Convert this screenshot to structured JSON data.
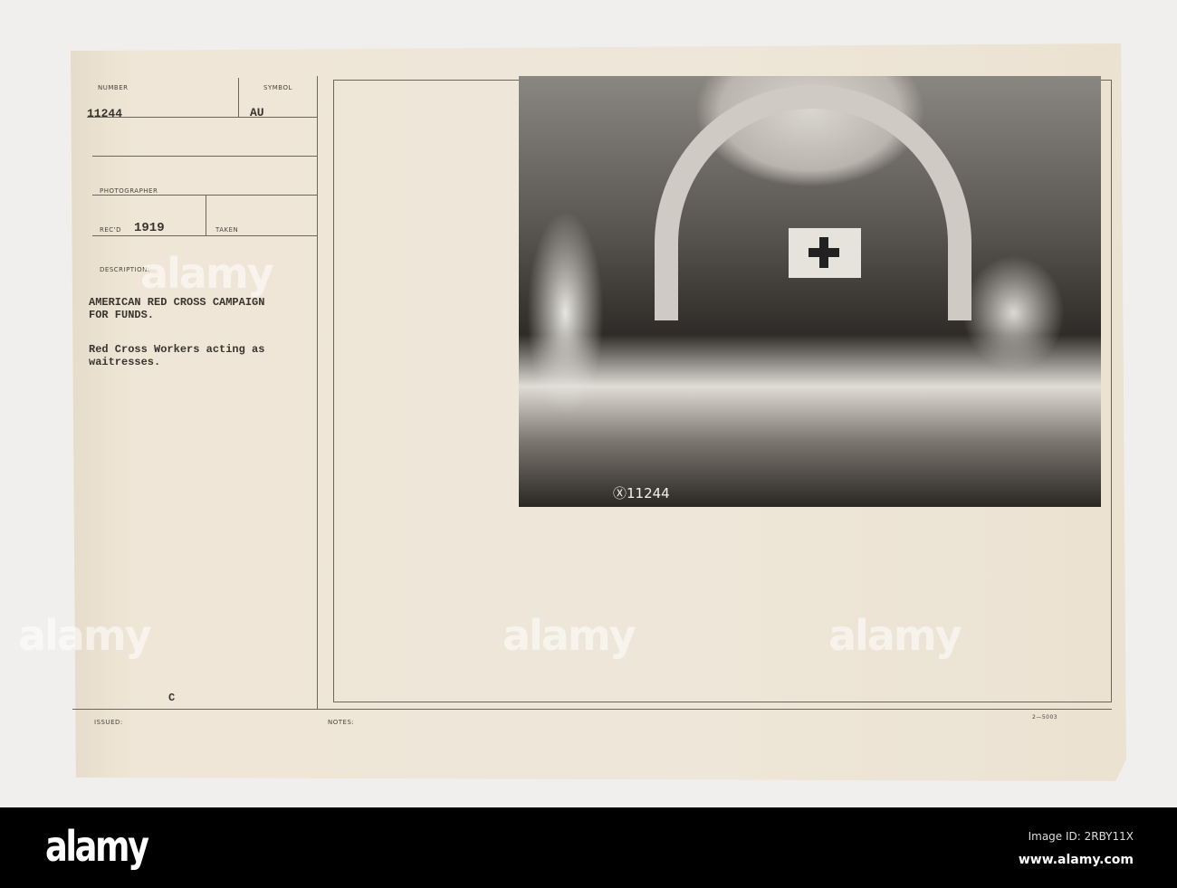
{
  "card": {
    "number_label": "NUMBER",
    "number": "11244",
    "symbol_label": "SYMBOL",
    "symbol": "AU",
    "photographer_label": "PHOTOGRAPHER",
    "recd_label": "REC'D",
    "recd": "1919",
    "taken_label": "TAKEN",
    "description_label": "DESCRIPTION:",
    "description_title": [
      "AMERICAN RED CROSS CAMPAIGN",
      "FOR FUNDS."
    ],
    "description_text": [
      "Red Cross Workers acting as",
      "waitresses."
    ],
    "mark": "C",
    "issued_label": "ISSUED:",
    "notes_label": "NOTES:",
    "form_number": "2—5003",
    "photo_number": "Ⓧ11244"
  },
  "watermark": "alamy",
  "footer": {
    "logo": "alamy",
    "image_id": "Image ID: 2RBY11X",
    "url": "www.alamy.com"
  }
}
